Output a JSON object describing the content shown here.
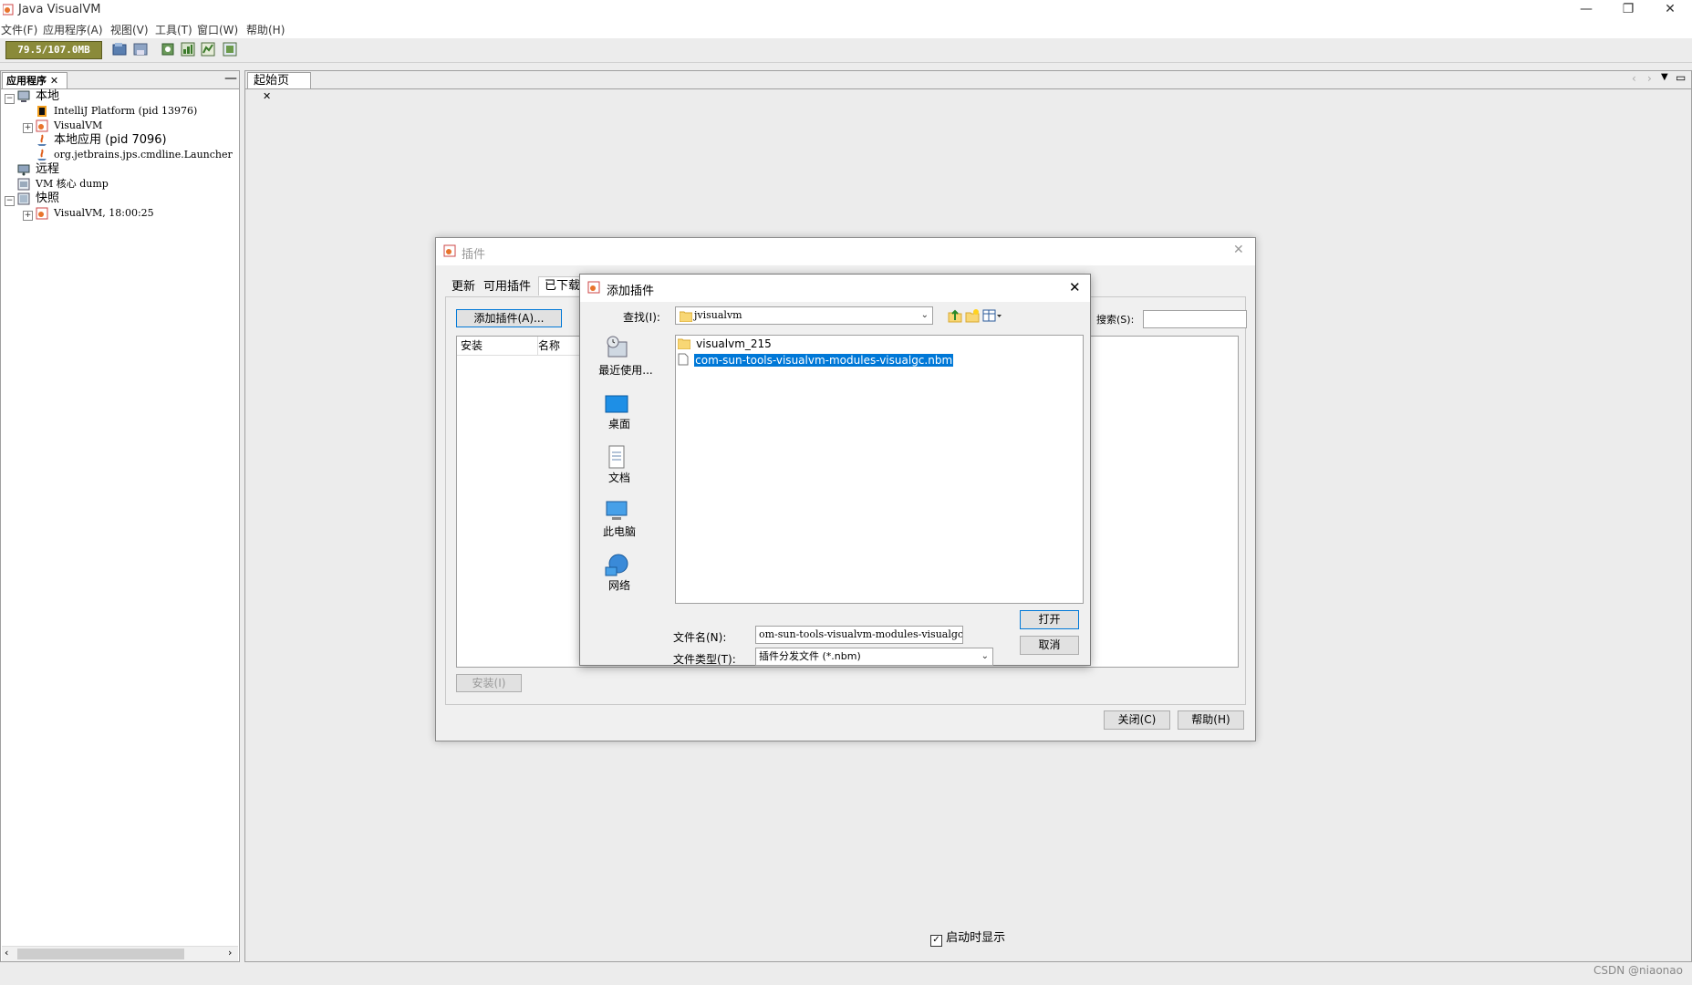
{
  "window": {
    "title": "Java VisualVM",
    "min": "—",
    "restore": "❐",
    "close": "✕"
  },
  "menu": [
    "文件(F)",
    "应用程序(A)",
    "视图(V)",
    "工具(T)",
    "窗口(W)",
    "帮助(H)"
  ],
  "toolbar": {
    "memory": "79.5/107.0MB"
  },
  "left_panel": {
    "tab_label": "应用程序",
    "tree": {
      "local": "本地",
      "intellij": "IntelliJ Platform (pid 13976)",
      "visualvm": "VisualVM",
      "local_app": "本地应用 (pid 7096)",
      "launcher": "org.jetbrains.jps.cmdline.Launcher",
      "remote": "远程",
      "vm_core": "VM 核心 dump",
      "snapshots": "快照",
      "snapshot_item": "VisualVM, 18:00:25"
    }
  },
  "workspace": {
    "tab_label": "起始页",
    "show_on_startup": "启动时显示",
    "show_on_startup_checked": true
  },
  "plugins_dialog": {
    "title": "插件",
    "tabs": [
      "更新",
      "可用插件",
      "已下载"
    ],
    "add_plugin_button": "添加插件(A)...",
    "columns": [
      "安装",
      "名称"
    ],
    "search_label": "搜索(S):",
    "install_button": "安装(I)",
    "close_button": "关闭(C)",
    "help_button": "帮助(H)"
  },
  "file_dialog": {
    "title": "添加插件",
    "look_in_label": "查找(I):",
    "look_in_value": "jvisualvm",
    "places": [
      "最近使用...",
      "桌面",
      "文档",
      "此电脑",
      "网络"
    ],
    "files": [
      {
        "name": "visualvm_215",
        "type": "folder",
        "selected": false
      },
      {
        "name": "com-sun-tools-visualvm-modules-visualgc.nbm",
        "type": "file",
        "selected": true
      }
    ],
    "filename_label": "文件名(N):",
    "filename_value": "om-sun-tools-visualvm-modules-visualgc.nbm",
    "filetype_label": "文件类型(T):",
    "filetype_value": "插件分发文件 (*.nbm)",
    "open_button": "打开",
    "cancel_button": "取消"
  },
  "watermark": "CSDN @niaonao",
  "colors": {
    "selection": "#0078d7",
    "accent": "#0078d7",
    "memory_bar": "#8a8a3a"
  }
}
